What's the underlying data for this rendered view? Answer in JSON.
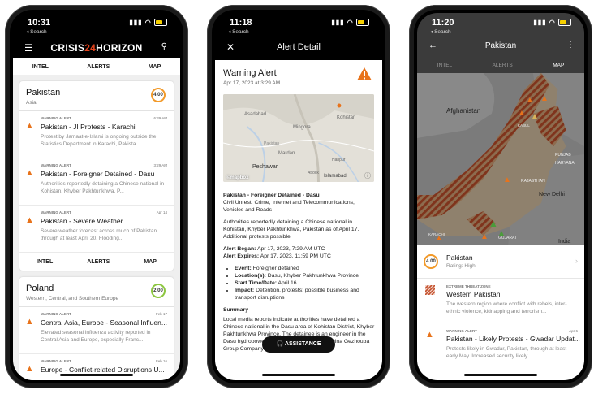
{
  "phone1": {
    "status": {
      "time": "10:31",
      "back": "◂ Search"
    },
    "brand": {
      "left": "CRISIS",
      "mid": "24",
      "right": "HORIZON"
    },
    "tabs": [
      "INTEL",
      "ALERTS",
      "MAP"
    ],
    "card1": {
      "country": "Pakistan",
      "region": "Asia",
      "rating": "4.00",
      "alerts": [
        {
          "label": "WARNING ALERT",
          "time": "6:39 AM",
          "title": "Pakistan - JI Protests - Karachi",
          "desc": "Protest by Jamaat-e-Islami is ongoing outside the Statistics Department in Karachi, Pakista..."
        },
        {
          "label": "WARNING ALERT",
          "time": "3:29 AM",
          "title": "Pakistan - Foreigner Detained - Dasu",
          "desc": "Authorities reportedly detaining a Chinese national in Kohistan, Khyber Pakhtunkhwa, P..."
        },
        {
          "label": "WARNING ALERT",
          "time": "Apr 14",
          "title": "Pakistan - Severe Weather",
          "desc": "Severe weather forecast across much of Pakistan through at least April 20. Flooding..."
        }
      ],
      "tabs": [
        "INTEL",
        "ALERTS",
        "MAP"
      ]
    },
    "card2": {
      "country": "Poland",
      "region": "Western, Central, and Southern Europe",
      "rating": "2.00",
      "alerts": [
        {
          "label": "WARNING ALERT",
          "time": "Feb 17",
          "title": "Central Asia, Europe - Seasonal Influen...",
          "desc": "Elevated seasonal influenza activity reported in Central Asia and Europe, especially Franc..."
        },
        {
          "label": "WARNING ALERT",
          "time": "Feb 16",
          "title": "Europe - Conflict-related Disruptions U...",
          "desc": ""
        }
      ]
    }
  },
  "phone2": {
    "status": {
      "time": "11:18",
      "back": "◂ Search"
    },
    "title": "Alert Detail",
    "alert_type": "Warning Alert",
    "alert_date": "Apr 17, 2023 at 3:29 AM",
    "map_labels": {
      "a": "Asadabad",
      "b": "Mingora",
      "c": "Kohistan",
      "d": "Mardan",
      "e": "Peshawar",
      "f": "Islamabad",
      "g": "Attock",
      "h": "Haripur",
      "i": "Pakistan",
      "j": "©mapbox"
    },
    "headline": "Pakistan - Foreigner Detained - Dasu",
    "categories": "Civil Unrest, Crime, Internet and Telecommunications, Vehicles and Roads",
    "body1": "Authorities reportedly detaining a Chinese national in Kohistan, Khyber Pakhtunkhwa, Pakistan as of April 17. Additional protests possible.",
    "began_label": "Alert Began:",
    "began": "Apr 17, 2023, 7:29 AM UTC",
    "expires_label": "Alert Expires:",
    "expires": "Apr 17, 2023, 11:59 PM UTC",
    "bullets": [
      {
        "k": "Event:",
        "v": "Foreigner detained"
      },
      {
        "k": "Location(s):",
        "v": "Dasu, Khyber Pakhtunkhwa Province"
      },
      {
        "k": "Start Time/Date:",
        "v": "April 16"
      },
      {
        "k": "Impact:",
        "v": "Detention, protests; possible business and transport disruptions"
      }
    ],
    "summary_h": "Summary",
    "summary": "Local media reports indicate authorities have detained a Chinese national in the Dasu area of Kohistan District, Khyber Pakhtunkhwa Province. The detainee is an engineer in the Dasu hydropower project employed by the China Gezhouba Group Company. Authorities",
    "assist": "ASSISTANCE"
  },
  "phone3": {
    "status": {
      "time": "11:20",
      "back": "◂ Search"
    },
    "title": "Pakistan",
    "tabs": [
      "INTEL",
      "ALERTS",
      "MAP"
    ],
    "map_labels": {
      "afg": "Afghanistan",
      "nd": "New Delhi",
      "raj": "RAJASTHAN",
      "ind": "India",
      "pun": "PUNJAB",
      "har": "HARYANA",
      "guj": "GUJARAT",
      "kab": "KABUL",
      "kar": "KARACHI"
    },
    "country": {
      "name": "Pakistan",
      "rating_label": "Rating: High",
      "rating": "4.00"
    },
    "zone": {
      "label": "EXTREME THREAT ZONE",
      "title": "Western Pakistan",
      "desc": "The western region where conflict with rebels, inter-ethnic violence, kidnapping and terrorism..."
    },
    "alert": {
      "label": "WARNING ALERT",
      "time": "Apr 6",
      "title": "Pakistan - Likely Protests - Gwadar Updat...",
      "desc": "Protests likely in Gwadar, Pakistan, through at least early May. Increased security likely."
    }
  }
}
